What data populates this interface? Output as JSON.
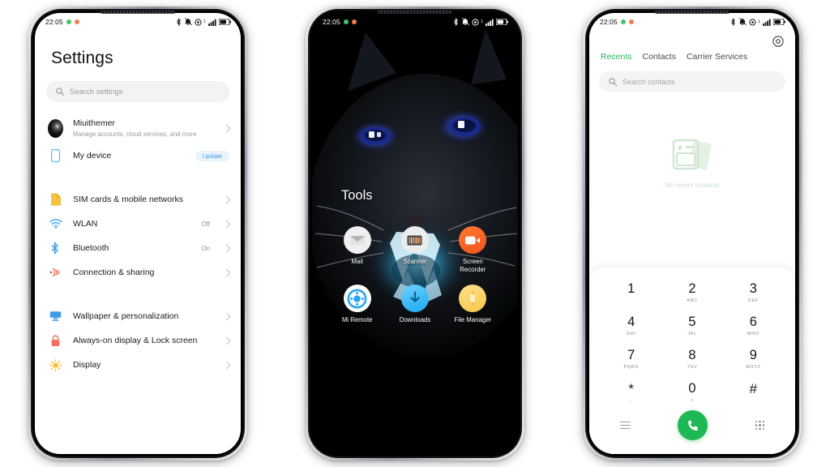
{
  "phones": {
    "settings": {
      "statusbar": {
        "time": "22:05",
        "dots": [
          "green",
          "orange"
        ],
        "icons": [
          "bluetooth-icon",
          "dnd-icon",
          "alarm-icon",
          "signal-icon",
          "battery-icon"
        ]
      },
      "title": "Settings",
      "search": {
        "placeholder": "Search settings",
        "icon": "search-icon"
      },
      "account": {
        "name": "Miuithemer",
        "subtitle": "Manage accounts, cloud services, and more"
      },
      "rows": [
        {
          "label": "My device",
          "badge": "Update",
          "icon": "device-icon"
        },
        {
          "label": "SIM cards & mobile networks",
          "value": "",
          "icon": "sim-icon"
        },
        {
          "label": "WLAN",
          "value": "Off",
          "icon": "wifi-icon"
        },
        {
          "label": "Bluetooth",
          "value": "On",
          "icon": "bluetooth-icon"
        },
        {
          "label": "Connection & sharing",
          "value": "",
          "icon": "connection-icon"
        },
        {
          "label": "Wallpaper & personalization",
          "value": "",
          "icon": "wallpaper-icon"
        },
        {
          "label": "Always-on display & Lock screen",
          "value": "",
          "icon": "lock-icon"
        },
        {
          "label": "Display",
          "value": "",
          "icon": "display-icon"
        }
      ]
    },
    "home": {
      "statusbar": {
        "time": "22:05",
        "dots": [
          "green",
          "orange"
        ],
        "icons": [
          "bluetooth-icon",
          "dnd-icon",
          "alarm-icon",
          "signal-icon",
          "battery-icon"
        ]
      },
      "folder_title": "Tools",
      "apps": [
        {
          "name": "Mail",
          "icon": "mail-icon"
        },
        {
          "name": "Scanner",
          "icon": "scanner-icon"
        },
        {
          "name": "Screen Recorder",
          "icon": "screen-recorder-icon"
        },
        {
          "name": "Mi Remote",
          "icon": "remote-icon"
        },
        {
          "name": "Downloads",
          "icon": "download-icon"
        },
        {
          "name": "File Manager",
          "icon": "file-manager-icon"
        }
      ]
    },
    "dialer": {
      "statusbar": {
        "time": "22:05",
        "dots": [
          "green",
          "orange"
        ],
        "icons": [
          "bluetooth-icon",
          "dnd-icon",
          "alarm-icon",
          "signal-icon",
          "battery-icon"
        ]
      },
      "settings_icon": "gear-icon",
      "tabs": [
        {
          "label": "Recents",
          "active": true
        },
        {
          "label": "Contacts",
          "active": false
        },
        {
          "label": "Carrier Services",
          "active": false
        }
      ],
      "search": {
        "placeholder": "Search contacts",
        "icon": "search-icon"
      },
      "empty_state": {
        "text": "No recent contacts",
        "icon": "contact-card-icon"
      },
      "keys": [
        {
          "num": "1",
          "sub": ""
        },
        {
          "num": "2",
          "sub": "ABC"
        },
        {
          "num": "3",
          "sub": "DEF"
        },
        {
          "num": "4",
          "sub": "GHI"
        },
        {
          "num": "5",
          "sub": "JKL"
        },
        {
          "num": "6",
          "sub": "MNO"
        },
        {
          "num": "7",
          "sub": "PQRS"
        },
        {
          "num": "8",
          "sub": "TUV"
        },
        {
          "num": "9",
          "sub": "WXYZ"
        },
        {
          "num": "*",
          "sub": ","
        },
        {
          "num": "0",
          "sub": "+"
        },
        {
          "num": "#",
          "sub": ""
        }
      ],
      "actions": {
        "menu_icon": "hamburger-menu-icon",
        "call_icon": "call-icon",
        "keypad_icon": "dialpad-icon"
      }
    }
  },
  "colors": {
    "accent_green": "#1db954",
    "badge_blue": "#3ea1e0",
    "sim_yellow": "#f5c242",
    "wifi_blue": "#4aa8e8",
    "lock_red": "#f2705c"
  }
}
